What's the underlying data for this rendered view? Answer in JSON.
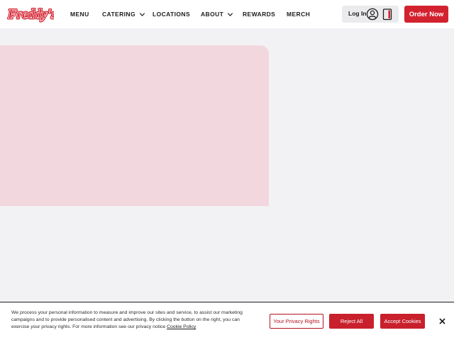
{
  "brand": {
    "logo_text": "Freddy's",
    "primary_color": "#d3222f"
  },
  "nav": {
    "items": [
      {
        "label": "MENU",
        "has_dropdown": false
      },
      {
        "label": "CATERING",
        "has_dropdown": true
      },
      {
        "label": "LOCATIONS",
        "has_dropdown": false
      },
      {
        "label": "ABOUT",
        "has_dropdown": true
      },
      {
        "label": "REWARDS",
        "has_dropdown": false
      },
      {
        "label": "MERCH",
        "has_dropdown": false
      }
    ],
    "login_label": "Log In",
    "user_icon": "user-circle-icon",
    "bag_icon": "shopping-bag-icon",
    "order_label": "Order Now"
  },
  "hero": {
    "placeholder_color": "#f2d8de"
  },
  "cookie_banner": {
    "text": "We process your personal information to measure and improve our sites and service, to assist our marketing campaigns and to provide personalised content and advertising. By clicking the button on the right, you can exercise your privacy rights. For more information see our privacy notice",
    "link_text": "Cookie Policy",
    "privacy_rights_label": "Your Privacy Rights",
    "reject_label": "Reject All",
    "accept_label": "Accept Cookies",
    "close_icon": "close-icon"
  }
}
